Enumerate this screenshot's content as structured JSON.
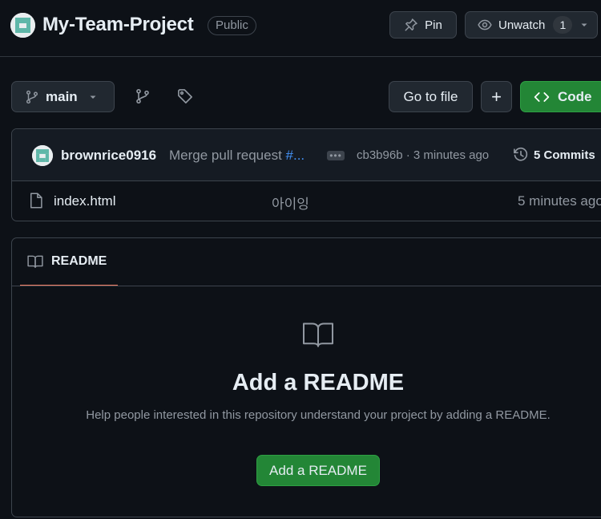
{
  "repo": {
    "name": "My-Team-Project",
    "visibility": "Public"
  },
  "header_actions": {
    "pin_label": "Pin",
    "watch_label": "Unwatch",
    "watch_count": "1"
  },
  "toolbar": {
    "branch": "main",
    "goto_file_label": "Go to file",
    "add_label": "+",
    "code_label": "Code"
  },
  "latest_commit": {
    "author": "brownrice0916",
    "message": "Merge pull request ",
    "message_link": "#...",
    "sha": "cb3b96b",
    "separator": "·",
    "time": "3 minutes ago",
    "commits_label": "5 Commits"
  },
  "files": [
    {
      "name": "index.html",
      "commit_message": "아이잉",
      "time": "5 minutes ago"
    }
  ],
  "readme": {
    "tab_label": "README",
    "heading": "Add a README",
    "description": "Help people interested in this repository understand your project by adding a README.",
    "button_label": "Add a README"
  },
  "icons": {
    "avatar": "identicon-avatar",
    "pin": "pin-icon",
    "watch": "eye-icon",
    "branch": "git-branch-icon",
    "tag": "tag-icon",
    "code": "code-icon",
    "history": "history-icon",
    "file": "file-icon",
    "book": "book-icon"
  },
  "colors": {
    "background": "#0d1117",
    "accent_green": "#238636",
    "link_blue": "#4493f8",
    "tab_underline": "#f78166"
  }
}
